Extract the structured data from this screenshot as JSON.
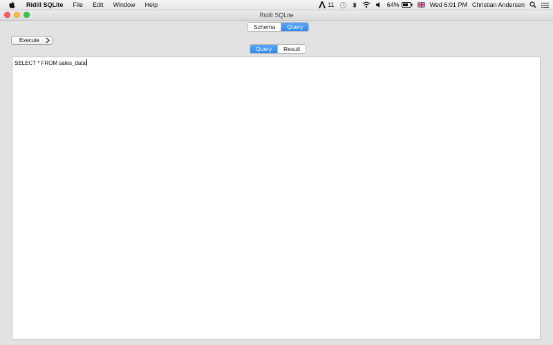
{
  "menubar": {
    "app_name": "Ridill SQLite",
    "items": [
      "File",
      "Edit",
      "Window",
      "Help"
    ],
    "status": {
      "notification_count": "11",
      "battery": "64%",
      "datetime": "Wed 6:01 PM",
      "user": "Christian Andersen"
    }
  },
  "window": {
    "title": "Ridill SQLite",
    "top_tabs": [
      {
        "label": "Schema",
        "active": false
      },
      {
        "label": "Query",
        "active": true
      }
    ],
    "execute_label": "Execute",
    "sub_tabs": [
      {
        "label": "Query",
        "active": true
      },
      {
        "label": "Result",
        "active": false
      }
    ],
    "editor_text": "SELECT * FROM sales_data"
  },
  "colors": {
    "accent": "#2f86f5",
    "close": "#fc605c",
    "minimize": "#fdbc40",
    "zoom": "#34c84a"
  }
}
